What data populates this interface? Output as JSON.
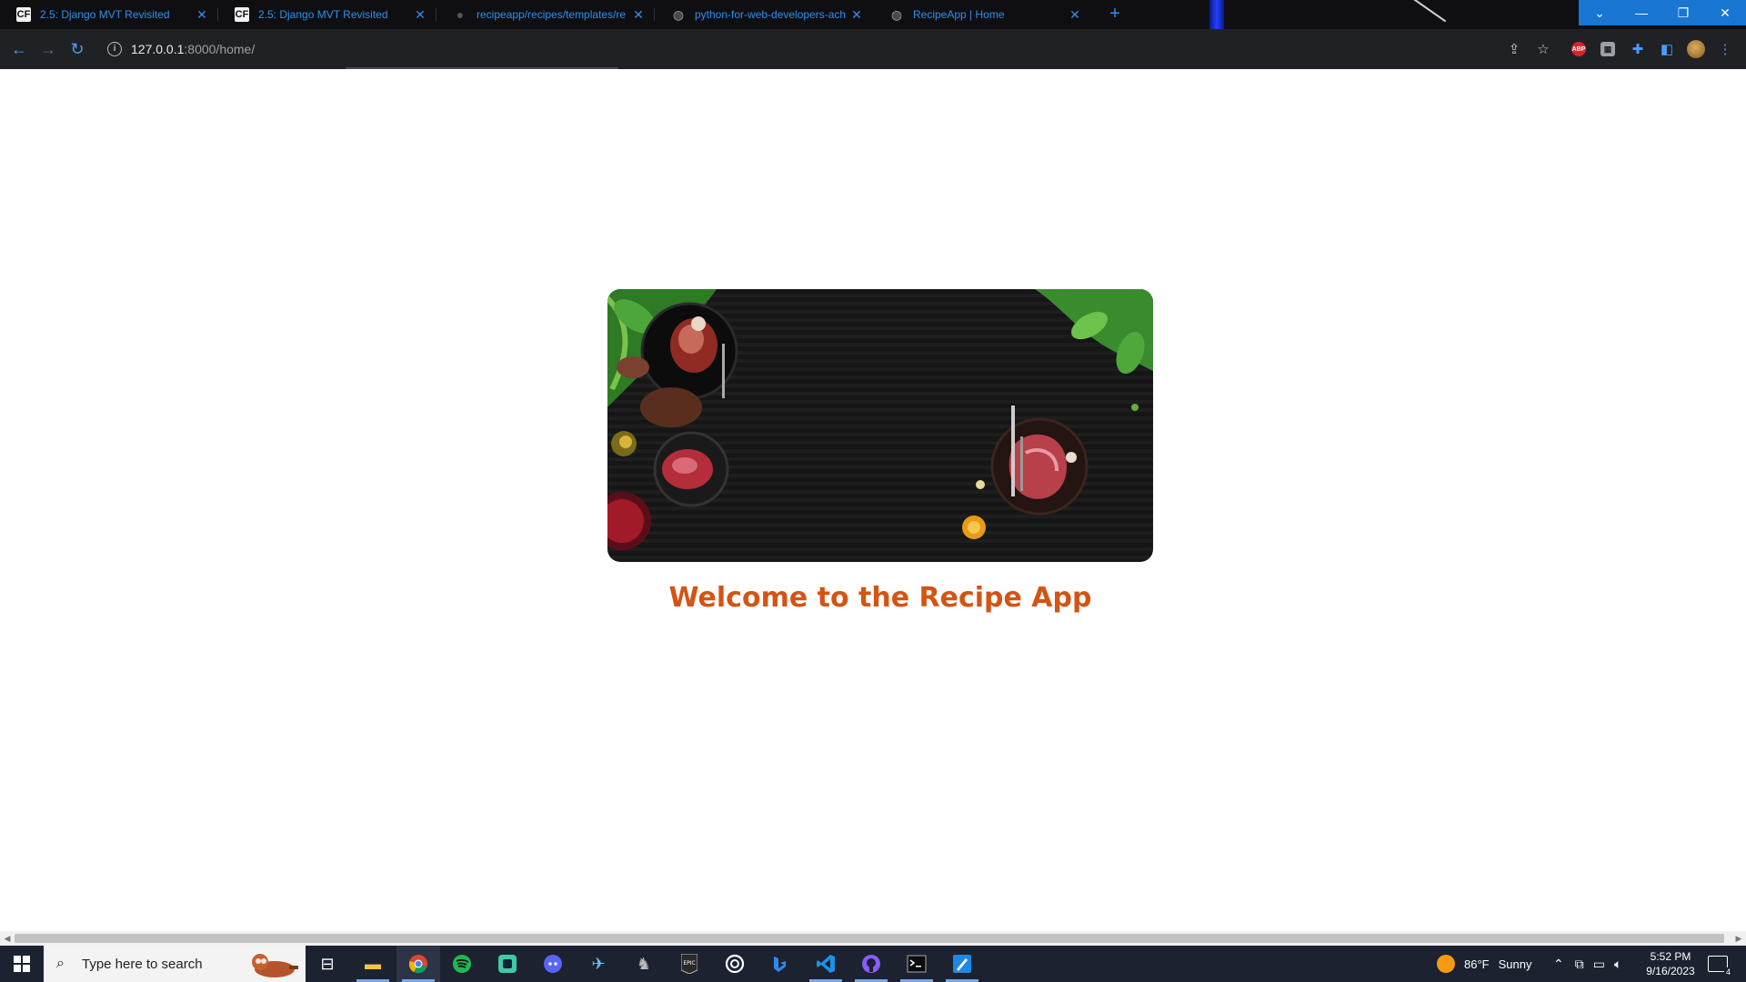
{
  "browser": {
    "tabs": [
      {
        "title": "2.5: Django MVT Revisited",
        "favicon": "cf-logo-icon"
      },
      {
        "title": "2.5: Django MVT Revisited",
        "favicon": "cf-logo-icon"
      },
      {
        "title": "recipeapp/recipes/templates/re",
        "favicon": "github-icon"
      },
      {
        "title": "python-for-web-developers-ach",
        "favicon": "globe-icon"
      },
      {
        "title": "RecipeApp | Home",
        "favicon": "globe-icon",
        "active": true
      }
    ],
    "url_host": "127.0.0.1",
    "url_rest": ":8000/home/",
    "extensions": [
      "share-icon",
      "bookmark-star-icon",
      "adblock-plus-icon",
      "extension-square-icon",
      "puzzle-icon",
      "sidebar-icon",
      "profile-avatar",
      "menu-kebab-icon"
    ],
    "accent": "#2f8ff0"
  },
  "page": {
    "hero_image": "food-on-dark-table-banner",
    "welcome": "Welcome to the Recipe App",
    "welcome_color": "#d35414"
  },
  "taskbar": {
    "search_placeholder": "Type here to search",
    "apps": [
      "task-view-icon",
      "file-explorer-icon",
      "chrome-icon",
      "spotify-icon",
      "gitkraken-icon",
      "discord-icon",
      "steam-icon",
      "game-icon",
      "epic-games-icon",
      "ubisoft-icon",
      "bing-icon",
      "vscode-icon",
      "github-desktop-icon",
      "terminal-icon",
      "paint-icon"
    ],
    "weather_temp": "86°F",
    "weather_text": "Sunny",
    "time": "5:52 PM",
    "date": "9/16/2023",
    "notifications": "4"
  }
}
